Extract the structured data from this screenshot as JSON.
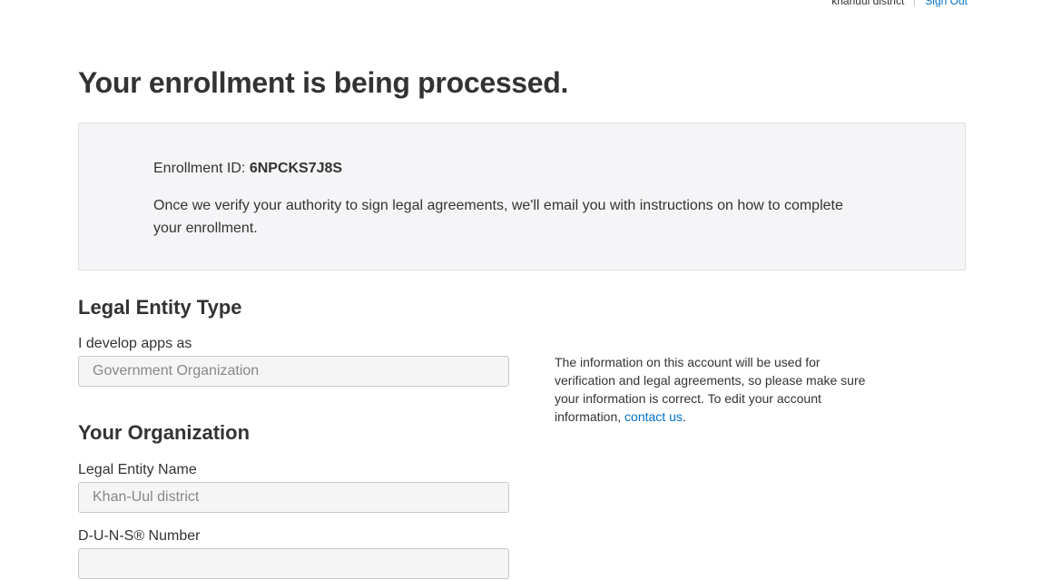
{
  "topbar": {
    "username": "khanuul district",
    "signout_label": "Sign Out"
  },
  "title": "Your enrollment is being processed.",
  "enrollment": {
    "id_label": "Enrollment ID: ",
    "id_value": "6NPCKS7J8S",
    "message": "Once we verify your authority to sign legal agreements, we'll email you with instructions on how to complete your enrollment."
  },
  "legal_entity": {
    "heading": "Legal Entity Type",
    "field_label": "I develop apps as",
    "field_value": "Government Organization"
  },
  "organization": {
    "heading": "Your Organization",
    "name_label": "Legal Entity Name",
    "name_value": "Khan-Uul district",
    "duns_label": "D-U-N-S® Number",
    "duns_value": ""
  },
  "side_note": {
    "text": "The information on this account will be used for verification and legal agreements, so please make sure your information is correct. To edit your account information, ",
    "link_label": "contact us",
    "trailing": "."
  },
  "colors": {
    "link": "#0070c9",
    "box_bg": "#f5f5f7"
  }
}
